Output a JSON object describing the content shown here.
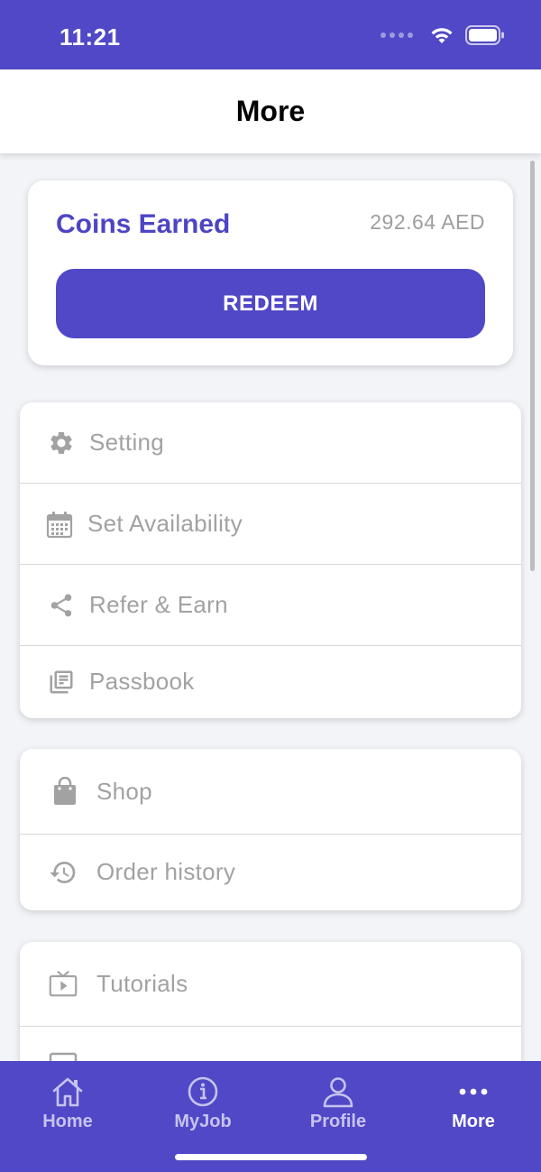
{
  "status": {
    "time": "11:21"
  },
  "header": {
    "title": "More"
  },
  "coins": {
    "title": "Coins Earned",
    "amount": "292.64 AED",
    "redeem_label": "REDEEM"
  },
  "menu_groups": [
    {
      "items": [
        {
          "label": "Setting",
          "icon": "gear-icon"
        },
        {
          "label": "Set Availability",
          "icon": "calendar-icon"
        },
        {
          "label": "Refer & Earn",
          "icon": "share-icon"
        },
        {
          "label": "Passbook",
          "icon": "library-books-icon"
        }
      ]
    },
    {
      "items": [
        {
          "label": "Shop",
          "icon": "shopping-bag-icon"
        },
        {
          "label": "Order history",
          "icon": "history-icon"
        }
      ]
    },
    {
      "items": [
        {
          "label": "Tutorials",
          "icon": "tv-icon"
        }
      ]
    }
  ],
  "nav": [
    {
      "label": "Home",
      "icon": "home-icon"
    },
    {
      "label": "MyJob",
      "icon": "info-icon"
    },
    {
      "label": "Profile",
      "icon": "person-icon"
    },
    {
      "label": "More",
      "icon": "more-dots-icon",
      "active": true
    }
  ],
  "colors": {
    "brand": "#5048C6",
    "accent_text": "#4D45C4",
    "muted_text": "#A2A2A2"
  }
}
